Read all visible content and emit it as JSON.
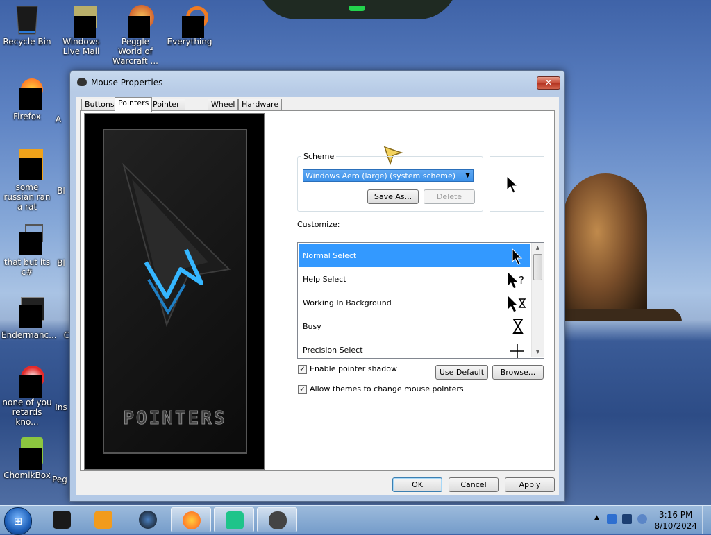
{
  "desktop": {
    "icons": [
      {
        "label": "Recycle Bin"
      },
      {
        "label": "Windows Live Mail"
      },
      {
        "label": "Peggle World of Warcraft ..."
      },
      {
        "label": "Everything"
      },
      {
        "label": "Firefox"
      },
      {
        "label": "some russian ran a rat"
      },
      {
        "label": "that but its c#"
      },
      {
        "label": "Endermanc..."
      },
      {
        "label": "none of you retards kno..."
      },
      {
        "label": "ChomikBox"
      }
    ],
    "partial_labels": [
      "A",
      "Bl",
      "Bl",
      "C",
      "Ins",
      "Peg"
    ]
  },
  "window": {
    "title": "Mouse Properties",
    "close_label": "✕",
    "tabs": [
      "Buttons",
      "Pointers",
      "Pointer Options",
      "Wheel",
      "Hardware"
    ],
    "active_tab": "Pointers",
    "art_title": "POINTERS",
    "scheme": {
      "legend": "Scheme",
      "selected": "Windows Aero (large) (system scheme)",
      "save_as": "Save As...",
      "delete": "Delete"
    },
    "customize_label": "Customize:",
    "cursors": [
      {
        "label": "Normal Select",
        "icon": "normal-select-icon",
        "glyph": "⬉"
      },
      {
        "label": "Help Select",
        "icon": "help-select-icon",
        "glyph": "⬉?"
      },
      {
        "label": "Working In Background",
        "icon": "working-icon",
        "glyph": "⬉⧗"
      },
      {
        "label": "Busy",
        "icon": "busy-icon",
        "glyph": "⧗"
      },
      {
        "label": "Precision Select",
        "icon": "crosshair-icon",
        "glyph": "+"
      }
    ],
    "enable_shadow": {
      "label": "Enable pointer shadow",
      "checked": true
    },
    "allow_themes": {
      "label": "Allow themes to change mouse pointers",
      "checked": true
    },
    "use_default": "Use Default",
    "browse": "Browse...",
    "ok": "OK",
    "cancel": "Cancel",
    "apply": "Apply"
  },
  "taskbar": {
    "time": "3:16 PM",
    "date": "8/10/2024"
  },
  "colors": {
    "selection": "#3399ff",
    "accent_cursor": "#f4d35e",
    "glow_blue": "#35b6ff"
  }
}
